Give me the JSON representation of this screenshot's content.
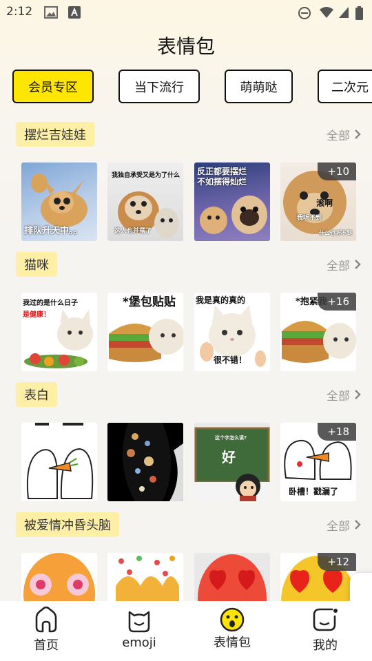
{
  "status": {
    "time": "2:12"
  },
  "page": {
    "title": "表情包"
  },
  "tabs": [
    {
      "label": "会员专区",
      "active": true
    },
    {
      "label": "当下流行",
      "active": false
    },
    {
      "label": "萌萌哒",
      "active": false
    },
    {
      "label": "二次元",
      "active": false
    }
  ],
  "more_label": "全部",
  "sections": [
    {
      "title": "摆烂吉娃娃",
      "thumbs": [
        {
          "caption": "排队升天中。。",
          "subject": "chihuahua-icon"
        },
        {
          "caption": "我独自承受又是为了什么",
          "caption2": "这人也并摆了",
          "subject": "chihuahua-icon"
        },
        {
          "caption": "反正都要摆烂\n不如摆得灿烂",
          "subject": "dog-icon"
        },
        {
          "caption": "滚啊",
          "caption2": "我听不到",
          "caption3": "什么也听不到",
          "badge": "+10",
          "subject": "chihuahua-icon"
        }
      ]
    },
    {
      "title": "猫咪",
      "thumbs": [
        {
          "caption": "我过的是什么日子",
          "caption2": "是健康！",
          "subject": "cat-icon"
        },
        {
          "caption": "*堡包贴贴",
          "subject": "cat-icon"
        },
        {
          "caption": "我是真的真的",
          "caption2": "很不错！",
          "subject": "cat-icon"
        },
        {
          "caption": "*抱紧我",
          "badge": "+16",
          "subject": "cat-icon"
        }
      ]
    },
    {
      "title": "表白",
      "thumbs": [
        {
          "caption": "",
          "subject": "bunny-icon"
        },
        {
          "caption": "",
          "subject": "planets-icon"
        },
        {
          "caption": "这个字怎么读?",
          "caption2": "好",
          "subject": "blackboard-icon"
        },
        {
          "caption": "卧槽！戳漏了",
          "badge": "+18",
          "subject": "bunny-icon"
        }
      ]
    },
    {
      "title": "被爱情冲昏头脑",
      "thumbs": [
        {
          "caption": "",
          "subject": "face-icon"
        },
        {
          "caption": "",
          "subject": "hearts-icon"
        },
        {
          "caption": "",
          "subject": "heart-eyes-icon"
        },
        {
          "caption": "",
          "badge": "+12",
          "subject": "heart-eyes-icon"
        }
      ]
    }
  ],
  "nav": [
    {
      "label": "首页",
      "icon": "home-icon"
    },
    {
      "label": "emoji",
      "icon": "cat-face-icon"
    },
    {
      "label": "表情包",
      "icon": "surprised-face-icon",
      "active": true
    },
    {
      "label": "我的",
      "icon": "profile-icon"
    }
  ],
  "colors": {
    "accent": "#ffe600",
    "section_title_bg": "#fdf0a6",
    "badge_bg": "#3c3c3c"
  }
}
